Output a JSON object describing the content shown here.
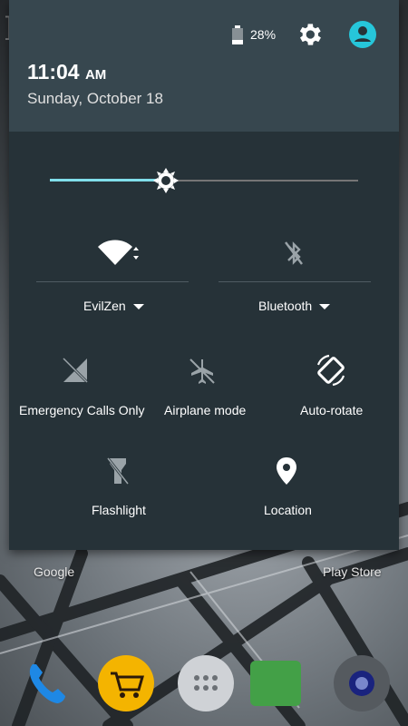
{
  "status": {
    "battery_percent": "28%",
    "battery_level": 0.28
  },
  "header": {
    "time": "11:04",
    "ampm": "AM",
    "date": "Sunday, October 18"
  },
  "brightness": {
    "level": 0.376
  },
  "tiles": {
    "wifi": {
      "label": "EvilZen",
      "icon": "wifi-icon"
    },
    "bluetooth": {
      "label": "Bluetooth",
      "icon": "bluetooth-disabled-icon"
    },
    "cellular": {
      "label": "Emergency Calls Only",
      "icon": "no-signal-icon"
    },
    "airplane": {
      "label": "Airplane mode",
      "icon": "airplane-icon"
    },
    "rotate": {
      "label": "Auto-rotate",
      "icon": "rotate-icon"
    },
    "flashlight": {
      "label": "Flashlight",
      "icon": "flashlight-icon"
    },
    "location": {
      "label": "Location",
      "icon": "location-pin-icon"
    }
  },
  "home": {
    "google_label": "Google",
    "playstore_label": "Play Store"
  },
  "colors": {
    "shade": "#263238",
    "header": "#37474f",
    "accent": "#80deea",
    "user_icon": "#26c6da"
  }
}
